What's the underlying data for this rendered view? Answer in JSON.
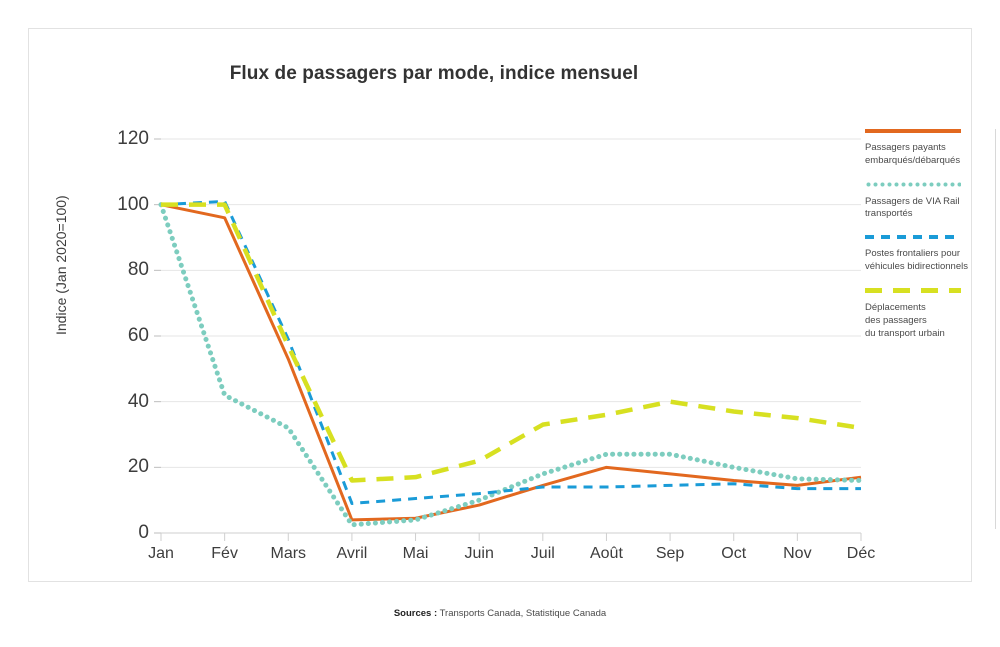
{
  "chart_data": {
    "type": "line",
    "title": "Flux de passagers par mode, indice mensuel",
    "xlabel": "",
    "ylabel": "Indice (Jan 2020=100)",
    "categories": [
      "Jan",
      "Fév",
      "Mars",
      "Avril",
      "Mai",
      "Juin",
      "Juil",
      "Août",
      "Sep",
      "Oct",
      "Nov",
      "Déc"
    ],
    "ylim": [
      0,
      120
    ],
    "yticks": [
      0,
      20,
      40,
      60,
      80,
      100,
      120
    ],
    "grid": true,
    "legend_position": "right",
    "series": [
      {
        "name": "Passagers payants embarqués/débarqués",
        "color": "#e2681f",
        "style": "solid",
        "values": [
          100,
          96,
          53,
          4,
          4.5,
          8.5,
          14.5,
          20,
          18,
          16,
          14.5,
          17
        ]
      },
      {
        "name": "Passagers de VIA Rail transportés",
        "color": "#7dcdbf",
        "style": "dotted",
        "values": [
          100,
          42,
          32,
          2.5,
          4,
          10,
          18,
          24,
          24,
          20,
          16.5,
          16
        ]
      },
      {
        "name": "Postes frontaliers pour véhicules bidirectionnels",
        "color": "#1a9bd7",
        "style": "dashed",
        "values": [
          100,
          101,
          59,
          9,
          10.5,
          12,
          14,
          14,
          14.5,
          15,
          13.5,
          13.5
        ]
      },
      {
        "name": "Déplacements des passagers du transport urbain",
        "color": "#d7e021",
        "style": "dashed-long",
        "values": [
          100,
          100,
          57,
          16,
          17,
          22,
          33,
          36,
          40,
          37,
          35,
          32
        ]
      }
    ]
  },
  "legend": {
    "items": [
      {
        "label": "Passagers payants\nembarqués/débarqués",
        "color": "#e2681f"
      },
      {
        "label": "Passagers de VIA Rail\ntransportés",
        "color": "#7dcdbf"
      },
      {
        "label": "Postes frontaliers pour\nvéhicules bidirectionnels",
        "color": "#1a9bd7"
      },
      {
        "label": "Déplacements\ndes passagers\ndu transport urbain",
        "color": "#d7e021"
      }
    ]
  },
  "source": {
    "prefix": "Sources :",
    "text": "Transports Canada, Statistique Canada"
  }
}
